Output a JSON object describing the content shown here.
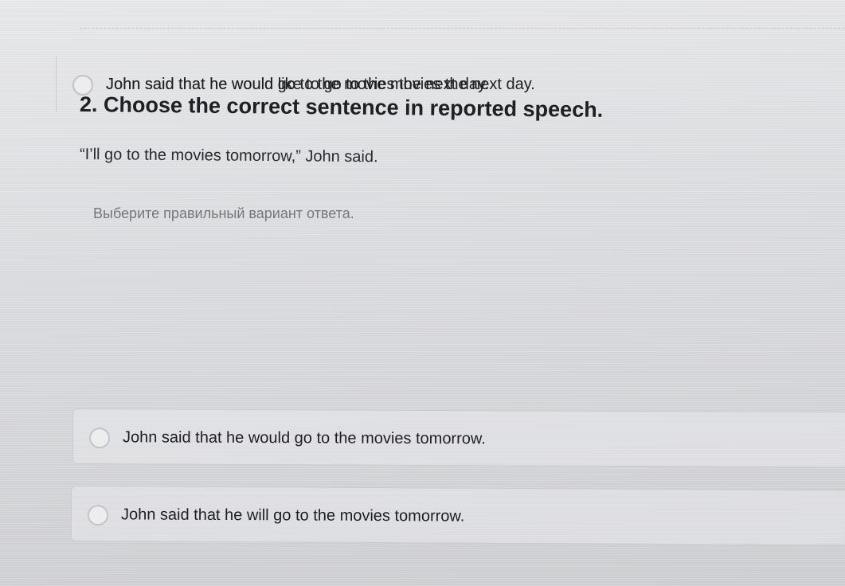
{
  "question": {
    "title": "2. Choose the correct sentence in reported speech.",
    "prompt": "“I’ll go to the movies tomorrow,” John said.",
    "instruction": "Выберите правильный вариант ответа."
  },
  "options": [
    {
      "label": "John said that he would go to the movies tomorrow.",
      "selected": false
    },
    {
      "label": "John said that he will go to the movies tomorrow.",
      "selected": false
    },
    {
      "label": "John said that he would go to the movies the next day.",
      "selected": false
    },
    {
      "label": "John said that he would like to go to the movies the next day.",
      "selected": false
    }
  ]
}
